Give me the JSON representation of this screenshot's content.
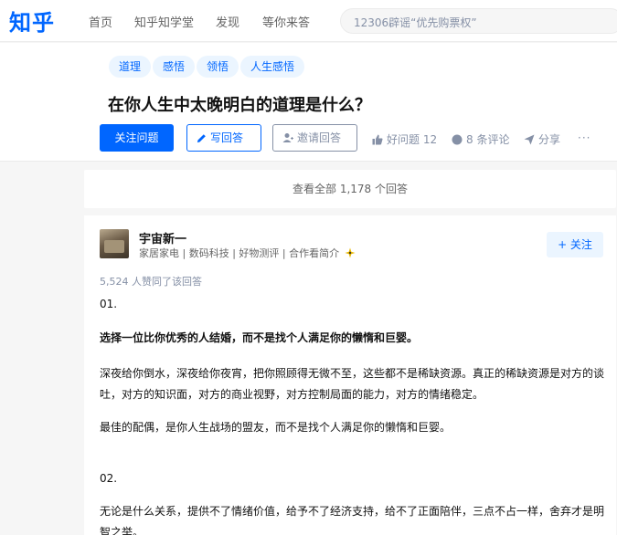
{
  "topbar": {
    "logo": "知乎",
    "nav": [
      "首页",
      "知乎知学堂",
      "发现",
      "等你来答"
    ],
    "search_value": "12306辟谣“优先购票权”"
  },
  "question": {
    "tags": [
      "道理",
      "感悟",
      "领悟",
      "人生感悟"
    ],
    "title": "在你人生中太晚明白的道理是什么？",
    "follow_label": "关注问题",
    "write_label": "写回答",
    "invite_label": "邀请回答",
    "good_question_label": "好问题 12",
    "comments_label": "8 条评论",
    "share_label": "分享",
    "more_label": "···"
  },
  "view_all": "查看全部 1,178 个回答",
  "answer": {
    "author": "宇宙新一",
    "bio": "家居家电 | 数码科技 | 好物测评 | 合作看简介",
    "follow_label": "+ 关注",
    "votes_text": "5,524 人赞同了该回答",
    "paragraphs": [
      "01.",
      "选择一位比你优秀的人结婚，而不是找个人满足你的懒惰和巨婴。",
      "深夜给你倒水，深夜给你夜宵，把你照顾得无微不至，这些都不是稀缺资源。真正的稀缺资源是对方的谈吐，对方的知识面，对方的商业视野，对方控制局面的能力，对方的情绪稳定。",
      "最佳的配偶，是你人生战场的盟友，而不是找个人满足你的懒惰和巨婴。",
      "02.",
      "无论是什么关系，提供不了情绪价值，给予不了经济支持，给不了正面陪伴，三点不占一样，舍弃才是明智之举。"
    ]
  },
  "colors": {
    "brand": "#0066ff",
    "tag_bg": "#ebf5ff",
    "muted": "#8590a6"
  }
}
